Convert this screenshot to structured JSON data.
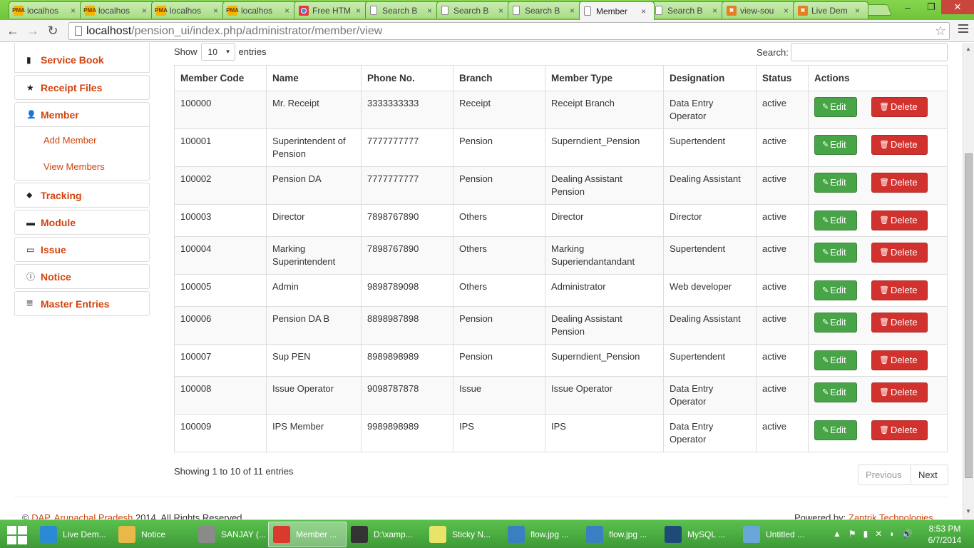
{
  "browser": {
    "tabs": [
      {
        "label": "localhos",
        "icon": "phpmyadmin-icon"
      },
      {
        "label": "localhos",
        "icon": "phpmyadmin-icon"
      },
      {
        "label": "localhos",
        "icon": "phpmyadmin-icon"
      },
      {
        "label": "localhos",
        "icon": "phpmyadmin-icon"
      },
      {
        "label": "Free HTM",
        "icon": "chrome-icon"
      },
      {
        "label": "Search B",
        "icon": "page-icon"
      },
      {
        "label": "Search B",
        "icon": "page-icon"
      },
      {
        "label": "Search B",
        "icon": "page-icon"
      },
      {
        "label": "Member",
        "icon": "page-icon",
        "active": true
      },
      {
        "label": "Search B",
        "icon": "page-icon"
      },
      {
        "label": "view-sou",
        "icon": "xampp-icon"
      },
      {
        "label": "Live Dem",
        "icon": "xampp-icon"
      }
    ],
    "tab_close": "×",
    "fav_pma": "PMA",
    "fav_x": "✖",
    "url_host": "localhost",
    "url_path": "/pension_ui/index.php/administrator/member/view",
    "back_glyph": "←",
    "forward_glyph": "→",
    "reload_glyph": "↻",
    "star_glyph": "☆",
    "minimize_glyph": "–",
    "maximize_glyph": "❐",
    "close_glyph": "✕"
  },
  "sidebar": {
    "items": [
      {
        "label": "Service Book",
        "icon": "book-icon",
        "glyph": "▮"
      },
      {
        "label": "Receipt Files",
        "icon": "star-icon",
        "glyph": "★"
      },
      {
        "label": "Member",
        "icon": "user-icon",
        "glyph": "👤"
      },
      {
        "label": "Tracking",
        "icon": "tags-icon",
        "glyph": "⬥"
      },
      {
        "label": "Module",
        "icon": "folder-icon",
        "glyph": "▬"
      },
      {
        "label": "Issue",
        "icon": "print-icon",
        "glyph": "▭"
      },
      {
        "label": "Notice",
        "icon": "info-icon",
        "glyph": "ⓘ"
      },
      {
        "label": "Master Entries",
        "icon": "list-icon",
        "glyph": "≡"
      }
    ],
    "member_sub": [
      "Add Member",
      "View Members"
    ]
  },
  "table_controls": {
    "show_label": "Show",
    "entries_label": "entries",
    "page_length": "10",
    "caret": "▼",
    "search_label": "Search:",
    "search_value": ""
  },
  "table": {
    "headers": [
      "Member Code",
      "Name",
      "Phone No.",
      "Branch",
      "Member Type",
      "Designation",
      "Status",
      "Actions"
    ],
    "edit_label": "Edit",
    "delete_label": "Delete",
    "edit_glyph": "✎",
    "delete_glyph": "🗑",
    "rows": [
      [
        "100000",
        "Mr. Receipt",
        "3333333333",
        "Receipt",
        "Receipt Branch",
        "Data Entry Operator",
        "active"
      ],
      [
        "100001",
        "Superintendent of Pension",
        "7777777777",
        "Pension",
        "Superndient_Pension",
        "Supertendent",
        "active"
      ],
      [
        "100002",
        "Pension DA",
        "7777777777",
        "Pension",
        "Dealing Assistant Pension",
        "Dealing Assistant",
        "active"
      ],
      [
        "100003",
        "Director",
        "7898767890",
        "Others",
        "Director",
        "Director",
        "active"
      ],
      [
        "100004",
        "Marking Superintendent",
        "7898767890",
        "Others",
        "Marking Superiendantandant",
        "Supertendent",
        "active"
      ],
      [
        "100005",
        "Admin",
        "9898789098",
        "Others",
        "Administrator",
        "Web developer",
        "active"
      ],
      [
        "100006",
        "Pension DA B",
        "8898987898",
        "Pension",
        "Dealing Assistant Pension",
        "Dealing Assistant",
        "active"
      ],
      [
        "100007",
        "Sup PEN",
        "8989898989",
        "Pension",
        "Superndient_Pension",
        "Supertendent",
        "active"
      ],
      [
        "100008",
        "Issue Operator",
        "9098787878",
        "Issue",
        "Issue Operator",
        "Data Entry Operator",
        "active"
      ],
      [
        "100009",
        "IPS Member",
        "9989898989",
        "IPS",
        "IPS",
        "Data Entry Operator",
        "active"
      ]
    ]
  },
  "pagination": {
    "info": "Showing 1 to 10 of 11 entries",
    "previous": "Previous",
    "next": "Next"
  },
  "footer": {
    "copyright_prefix": "© ",
    "org_link": "DAP, Arunachal Pradesh",
    "copyright_suffix": " 2014. All Rights Reserved",
    "powered_prefix": "Powered by: ",
    "powered_link": "Zantrik Technologies"
  },
  "taskbar": {
    "items": [
      {
        "label": "Live Dem...",
        "icon": "ie-icon",
        "color": "#2a8ad4"
      },
      {
        "label": "Notice",
        "icon": "folder-icon",
        "color": "#e8b84a"
      },
      {
        "label": "SANJAY (...",
        "icon": "drive-icon",
        "color": "#8a8a8a"
      },
      {
        "label": "Member ...",
        "icon": "chrome-icon",
        "color": "#d93a2b",
        "active": true
      },
      {
        "label": "D:\\xamp...",
        "icon": "sublime-icon",
        "color": "#333333"
      },
      {
        "label": "Sticky N...",
        "icon": "sticky-notes-icon",
        "color": "#e9e36a"
      },
      {
        "label": "flow.jpg ...",
        "icon": "image-viewer-icon",
        "color": "#3a7fc1"
      },
      {
        "label": "flow.jpg ...",
        "icon": "image-viewer-icon",
        "color": "#3a7fc1"
      },
      {
        "label": "MySQL ...",
        "icon": "mysql-icon",
        "color": "#1e4a78"
      },
      {
        "label": "Untitled ...",
        "icon": "paint-icon",
        "color": "#6aa6d8"
      }
    ],
    "tray_glyphs": [
      "▲",
      "⚑",
      "▮",
      "✕",
      "◗",
      "🔊"
    ],
    "time": "8:53 PM",
    "date": "6/7/2014"
  }
}
